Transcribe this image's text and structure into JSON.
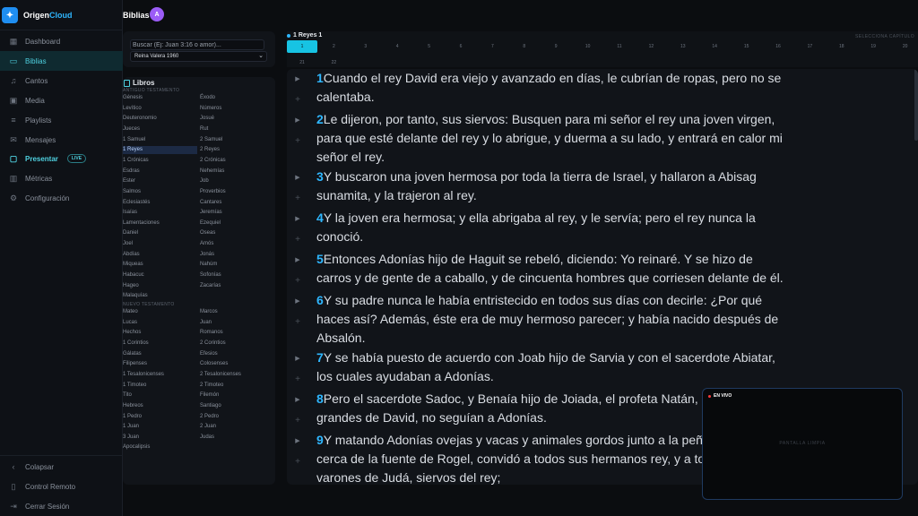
{
  "brand": {
    "name_a": "Origen",
    "name_b": "Cloud"
  },
  "sidebar": {
    "items": [
      {
        "label": "Dashboard",
        "icon": "grid-icon"
      },
      {
        "label": "Biblias",
        "icon": "book-icon"
      },
      {
        "label": "Cantos",
        "icon": "music-icon"
      },
      {
        "label": "Media",
        "icon": "image-icon"
      },
      {
        "label": "Playlists",
        "icon": "list-icon"
      },
      {
        "label": "Mensajes",
        "icon": "message-icon"
      },
      {
        "label": "Presentar",
        "icon": "monitor-icon",
        "badge": "LIVE"
      },
      {
        "label": "Métricas",
        "icon": "chart-icon"
      },
      {
        "label": "Configuración",
        "icon": "gear-icon"
      }
    ],
    "bottom": [
      {
        "label": "Colapsar",
        "icon": "chevron-left-icon"
      },
      {
        "label": "Control Remoto",
        "icon": "phone-icon"
      },
      {
        "label": "Cerrar Sesión",
        "icon": "logout-icon"
      }
    ]
  },
  "header": {
    "title": "Biblias",
    "avatar": "A"
  },
  "search": {
    "placeholder": "Buscar (Ej: Juan 3:16 o amor)...",
    "version": "Reina Valera 1960"
  },
  "books": {
    "title": "Libros",
    "ot_label": "ANTIGUO TESTAMENTO",
    "nt_label": "NUEVO TESTAMENTO",
    "old": [
      "Génesis",
      "Éxodo",
      "Levítico",
      "Números",
      "Deuteronomio",
      "Josué",
      "Jueces",
      "Rut",
      "1 Samuel",
      "2 Samuel",
      "1 Reyes",
      "2 Reyes",
      "1 Crónicas",
      "2 Crónicas",
      "Esdras",
      "Nehemías",
      "Ester",
      "Job",
      "Salmos",
      "Proverbios",
      "Eclesiastés",
      "Cantares",
      "Isaías",
      "Jeremías",
      "Lamentaciones",
      "Ezequiel",
      "Daniel",
      "Oseas",
      "Joel",
      "Amós",
      "Abdías",
      "Jonás",
      "Miqueas",
      "Nahúm",
      "Habacuc",
      "Sofonías",
      "Hageo",
      "Zacarías",
      "Malaquías"
    ],
    "new": [
      "Mateo",
      "Marcos",
      "Lucas",
      "Juan",
      "Hechos",
      "Romanos",
      "1 Corintios",
      "2 Corintios",
      "Gálatas",
      "Efesios",
      "Filipenses",
      "Colosenses",
      "1 Tesalonicenses",
      "2 Tesalonicenses",
      "1 Timoteo",
      "2 Timoteo",
      "Tito",
      "Filemón",
      "Hebreos",
      "Santiago",
      "1 Pedro",
      "2 Pedro",
      "1 Juan",
      "2 Juan",
      "3 Juan",
      "Judas",
      "Apocalipsis"
    ],
    "selected": "1 Reyes"
  },
  "chapters": {
    "title": "1 Reyes 1",
    "hint": "SELECCIONA CAPÍTULO",
    "list": [
      "1",
      "2",
      "3",
      "4",
      "5",
      "6",
      "7",
      "8",
      "9",
      "10",
      "11",
      "12",
      "13",
      "14",
      "15",
      "16",
      "17",
      "18",
      "19",
      "20",
      "21",
      "22"
    ],
    "active": "1"
  },
  "verses": [
    {
      "num": "1",
      "text": "Cuando el rey David era viejo y avanzado en días, le cubrían de ropas, pero no se calentaba."
    },
    {
      "num": "2",
      "text": "Le dijeron, por tanto, sus siervos: Busquen para mi señor el rey una joven virgen, para que esté delante del rey y lo abrigue, y duerma a su lado, y entrará en calor mi señor el rey."
    },
    {
      "num": "3",
      "text": "Y buscaron una joven hermosa por toda la tierra de Israel, y hallaron a Abisag sunamita, y la trajeron al rey."
    },
    {
      "num": "4",
      "text": "Y la joven era hermosa; y ella abrigaba al rey, y le servía; pero el rey nunca la conoció."
    },
    {
      "num": "5",
      "text": "Entonces Adonías hijo de Haguit se rebeló, diciendo: Yo reinaré. Y se hizo de carros y de gente de a caballo, y de cincuenta hombres que corriesen delante de él."
    },
    {
      "num": "6",
      "text": "Y su padre nunca le había entristecido en todos sus días con decirle: ¿Por qué haces así? Además, éste era de muy hermoso parecer; y había nacido después de Absalón."
    },
    {
      "num": "7",
      "text": "Y se había puesto de acuerdo con Joab hijo de Sarvia y con el sacerdote Abiatar, los cuales ayudaban a Adonías."
    },
    {
      "num": "8",
      "text": "Pero el sacerdote Sadoc, y Benaía hijo de Joiada, el profeta Natán, Si todos los grandes de David, no seguían a Adonías."
    },
    {
      "num": "9",
      "text": "Y matando Adonías ovejas y vacas y animales gordos junto a la peña la cual está cerca de la fuente de Rogel, convidó a todos sus hermanos rey, y a todos los varones de Judá, siervos del rey;"
    }
  ],
  "live": {
    "label": "EN VIVO",
    "empty": "PANTALLA LIMPIA"
  }
}
